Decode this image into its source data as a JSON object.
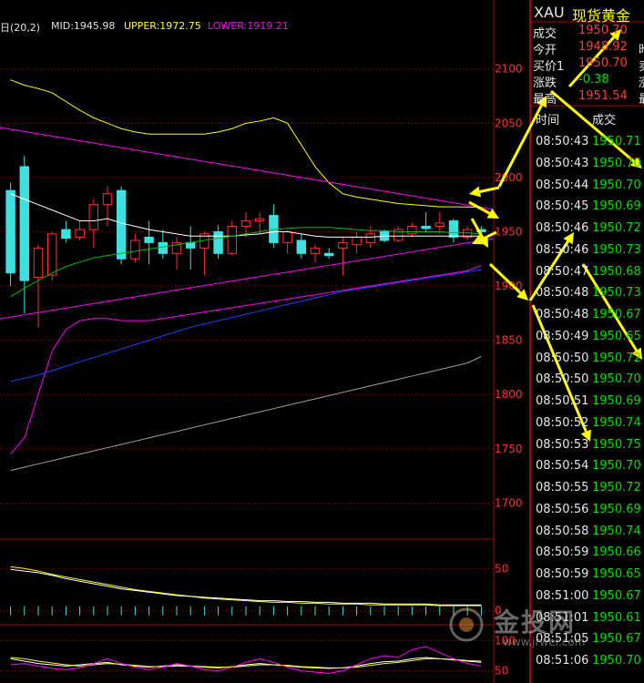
{
  "indicator": {
    "name": "日(20,2)",
    "mid": "MID:1945.98",
    "upper": "UPPER:1972.75",
    "lower": "LOWER:1919.21",
    "colors": {
      "mid": "#ffffff",
      "upper": "#ffff00",
      "lower": "#ff00ff"
    }
  },
  "quote": {
    "symbol": "XAU",
    "name": "现货黄金",
    "rows": [
      {
        "label": "成交",
        "value": "1950.70",
        "color": "red",
        "edge": ""
      },
      {
        "label": "今开",
        "value": "1948.92",
        "color": "red",
        "edge": "昨"
      },
      {
        "label": "买价1",
        "value": "1950.70",
        "color": "red",
        "edge": "卖"
      },
      {
        "label": "涨跌",
        "value": "-0.38",
        "color": "green",
        "edge": "涨"
      },
      {
        "label": "最高",
        "value": "1951.54",
        "color": "red",
        "edge": "最"
      }
    ],
    "ticks_header": {
      "time": "时间",
      "price": "成交"
    },
    "ticks": [
      {
        "time": "08:50:43",
        "price": "1950.71"
      },
      {
        "time": "08:50:43",
        "price": "1950.70"
      },
      {
        "time": "08:50:44",
        "price": "1950.70"
      },
      {
        "time": "08:50:45",
        "price": "1950.69"
      },
      {
        "time": "08:50:46",
        "price": "1950.72"
      },
      {
        "time": "08:50:46",
        "price": "1950.73"
      },
      {
        "time": "08:50:47",
        "price": "1950.68"
      },
      {
        "time": "08:50:48",
        "price": "1950.73"
      },
      {
        "time": "08:50:48",
        "price": "1950.67"
      },
      {
        "time": "08:50:49",
        "price": "1950.65"
      },
      {
        "time": "08:50:50",
        "price": "1950.72"
      },
      {
        "time": "08:50:50",
        "price": "1950.70"
      },
      {
        "time": "08:50:51",
        "price": "1950.69"
      },
      {
        "time": "08:50:52",
        "price": "1950.74"
      },
      {
        "time": "08:50:53",
        "price": "1950.75"
      },
      {
        "time": "08:50:54",
        "price": "1950.70"
      },
      {
        "time": "08:50:55",
        "price": "1950.72"
      },
      {
        "time": "08:50:56",
        "price": "1950.69"
      },
      {
        "time": "08:50:58",
        "price": "1950.74"
      },
      {
        "time": "08:50:59",
        "price": "1950.66"
      },
      {
        "time": "08:50:59",
        "price": "1950.65"
      },
      {
        "time": "08:51:00",
        "price": "1950.67"
      },
      {
        "time": "08:51:01",
        "price": "1950.61"
      },
      {
        "time": "08:51:05",
        "price": "1950.67"
      },
      {
        "time": "08:51:06",
        "price": "1950.70"
      }
    ]
  },
  "watermark": {
    "text": "金投网",
    "url": "www.jrwei.com"
  },
  "colors": {
    "up": "#ff3030",
    "down": "#40e0e0",
    "grid": "#8b1010",
    "axis_text": "#ff3030",
    "arrow": "#ffff00",
    "trend": "#ff00ff"
  },
  "chart_data": [
    {
      "type": "candlestick",
      "title": "",
      "ylim": [
        1660,
        2130
      ],
      "y_ticks": [
        1700,
        1750,
        1800,
        1850,
        1900,
        1950,
        2000,
        2050,
        2100
      ],
      "candles": [
        {
          "o": 1988,
          "h": 1995,
          "l": 1900,
          "c": 1912
        },
        {
          "o": 2010,
          "h": 2020,
          "l": 1875,
          "c": 1905
        },
        {
          "o": 1908,
          "h": 1938,
          "l": 1862,
          "c": 1935
        },
        {
          "o": 1910,
          "h": 1950,
          "l": 1905,
          "c": 1948
        },
        {
          "o": 1952,
          "h": 1960,
          "l": 1940,
          "c": 1944
        },
        {
          "o": 1945,
          "h": 1960,
          "l": 1942,
          "c": 1952
        },
        {
          "o": 1952,
          "h": 1980,
          "l": 1935,
          "c": 1975
        },
        {
          "o": 1975,
          "h": 1992,
          "l": 1955,
          "c": 1985
        },
        {
          "o": 1988,
          "h": 1992,
          "l": 1920,
          "c": 1925
        },
        {
          "o": 1925,
          "h": 1948,
          "l": 1922,
          "c": 1942
        },
        {
          "o": 1945,
          "h": 1960,
          "l": 1920,
          "c": 1940
        },
        {
          "o": 1940,
          "h": 1952,
          "l": 1925,
          "c": 1930
        },
        {
          "o": 1930,
          "h": 1945,
          "l": 1915,
          "c": 1940
        },
        {
          "o": 1940,
          "h": 1955,
          "l": 1915,
          "c": 1935
        },
        {
          "o": 1935,
          "h": 1950,
          "l": 1910,
          "c": 1948
        },
        {
          "o": 1950,
          "h": 1956,
          "l": 1925,
          "c": 1930
        },
        {
          "o": 1930,
          "h": 1960,
          "l": 1928,
          "c": 1955
        },
        {
          "o": 1955,
          "h": 1968,
          "l": 1945,
          "c": 1960
        },
        {
          "o": 1960,
          "h": 1968,
          "l": 1948,
          "c": 1962
        },
        {
          "o": 1965,
          "h": 1975,
          "l": 1935,
          "c": 1940
        },
        {
          "o": 1940,
          "h": 1952,
          "l": 1930,
          "c": 1950
        },
        {
          "o": 1942,
          "h": 1948,
          "l": 1925,
          "c": 1930
        },
        {
          "o": 1930,
          "h": 1938,
          "l": 1922,
          "c": 1935
        },
        {
          "o": 1930,
          "h": 1935,
          "l": 1925,
          "c": 1928
        },
        {
          "o": 1935,
          "h": 1945,
          "l": 1910,
          "c": 1940
        },
        {
          "o": 1938,
          "h": 1950,
          "l": 1930,
          "c": 1945
        },
        {
          "o": 1940,
          "h": 1955,
          "l": 1935,
          "c": 1948
        },
        {
          "o": 1950,
          "h": 1952,
          "l": 1940,
          "c": 1942
        },
        {
          "o": 1942,
          "h": 1955,
          "l": 1940,
          "c": 1952
        },
        {
          "o": 1948,
          "h": 1958,
          "l": 1945,
          "c": 1955
        },
        {
          "o": 1955,
          "h": 1968,
          "l": 1950,
          "c": 1953
        },
        {
          "o": 1955,
          "h": 1968,
          "l": 1948,
          "c": 1958
        },
        {
          "o": 1960,
          "h": 1962,
          "l": 1940,
          "c": 1945
        },
        {
          "o": 1945,
          "h": 1955,
          "l": 1942,
          "c": 1952
        },
        {
          "o": 1952,
          "h": 1955,
          "l": 1946,
          "c": 1950
        }
      ],
      "series": [
        {
          "color": "#ffff00",
          "values": [
            2090,
            2085,
            2082,
            2078,
            2070,
            2062,
            2055,
            2050,
            2045,
            2042,
            2040,
            2040,
            2040,
            2040,
            2040,
            2042,
            2045,
            2050,
            2052,
            2055,
            2050,
            2030,
            2010,
            1995,
            1985,
            1982,
            1980,
            1978,
            1976,
            1975,
            1974,
            1973,
            1973,
            1972.75,
            1972.75
          ]
        },
        {
          "color": "#ffffff",
          "values": [
            1985,
            1980,
            1975,
            1970,
            1965,
            1960,
            1960,
            1962,
            1958,
            1955,
            1952,
            1950,
            1948,
            1946,
            1946,
            1946,
            1946,
            1947,
            1948,
            1950,
            1950,
            1948,
            1946,
            1945,
            1945,
            1945,
            1945,
            1946,
            1946,
            1946,
            1946,
            1946,
            1946,
            1946,
            1945.98
          ]
        },
        {
          "color": "#00c000",
          "values": [
            1890,
            1898,
            1905,
            1912,
            1918,
            1922,
            1926,
            1928,
            1930,
            1932,
            1934,
            1936,
            1938,
            1940,
            1942,
            1944,
            1946,
            1948,
            1950,
            1952,
            1953,
            1954,
            1954,
            1954,
            1953,
            1952,
            1951,
            1951,
            1950,
            1950,
            1950,
            1950,
            1949,
            1949,
            1948
          ]
        },
        {
          "color": "#ff00ff",
          "values": [
            1745,
            1760,
            1800,
            1840,
            1860,
            1868,
            1870,
            1870,
            1868,
            1868,
            1868,
            1870,
            1872,
            1874,
            1876,
            1878,
            1880,
            1882,
            1884,
            1886,
            1888,
            1890,
            1892,
            1894,
            1896,
            1898,
            1900,
            1902,
            1904,
            1906,
            1908,
            1910,
            1912,
            1914,
            1919.21
          ]
        },
        {
          "color": "#2040ff",
          "values": [
            1812,
            1815,
            1818,
            1822,
            1826,
            1830,
            1834,
            1838,
            1842,
            1846,
            1850,
            1854,
            1858,
            1862,
            1865,
            1868,
            1871,
            1874,
            1877,
            1880,
            1883,
            1886,
            1889,
            1892,
            1895,
            1897,
            1899,
            1901,
            1903,
            1905,
            1907,
            1909,
            1911,
            1913,
            1915
          ]
        },
        {
          "color": "#a0a0a0",
          "values": [
            1730,
            1733,
            1736,
            1739,
            1742,
            1745,
            1748,
            1751,
            1754,
            1757,
            1760,
            1763,
            1766,
            1769,
            1772,
            1775,
            1778,
            1781,
            1784,
            1787,
            1790,
            1793,
            1796,
            1799,
            1802,
            1805,
            1808,
            1811,
            1814,
            1817,
            1820,
            1823,
            1826,
            1829,
            1835
          ]
        }
      ]
    },
    {
      "type": "line",
      "title": "",
      "ylim": [
        -10,
        60
      ],
      "y_ticks": [
        0,
        50
      ],
      "series": [
        {
          "color": "#ffff00",
          "values": [
            52,
            50,
            47,
            43,
            40,
            37,
            34,
            31,
            28,
            25,
            23,
            21,
            19,
            17,
            15,
            14,
            13,
            12,
            11,
            10,
            10,
            9,
            9,
            8,
            8,
            8,
            7,
            7,
            7,
            7,
            7,
            6,
            6,
            6,
            6
          ]
        },
        {
          "color": "#ffffff",
          "values": [
            49,
            47,
            45,
            42,
            38,
            35,
            32,
            29,
            26,
            24,
            22,
            20,
            18,
            17,
            16,
            15,
            14,
            13,
            12,
            12,
            11,
            11,
            10,
            10,
            9,
            9,
            9,
            8,
            8,
            8,
            8,
            7,
            7,
            7,
            7
          ]
        }
      ]
    },
    {
      "type": "line",
      "title": "",
      "ylim": [
        30,
        120
      ],
      "y_ticks": [
        50,
        100
      ],
      "series": [
        {
          "color": "#ffffff",
          "values": [
            70,
            66,
            62,
            60,
            58,
            60,
            62,
            64,
            60,
            58,
            56,
            58,
            60,
            58,
            56,
            55,
            57,
            60,
            62,
            60,
            58,
            56,
            55,
            54,
            55,
            58,
            62,
            65,
            66,
            70,
            72,
            70,
            68,
            66,
            64
          ]
        },
        {
          "color": "#ffff00",
          "values": [
            72,
            70,
            66,
            63,
            60,
            58,
            60,
            62,
            61,
            59,
            57,
            57,
            58,
            58,
            57,
            56,
            56,
            58,
            60,
            60,
            59,
            57,
            56,
            55,
            55,
            56,
            59,
            62,
            64,
            67,
            70,
            70,
            69,
            67,
            66
          ]
        },
        {
          "color": "#ff00ff",
          "values": [
            60,
            62,
            58,
            54,
            52,
            55,
            62,
            70,
            62,
            56,
            52,
            56,
            62,
            58,
            52,
            50,
            56,
            64,
            70,
            64,
            56,
            50,
            48,
            46,
            50,
            60,
            70,
            75,
            72,
            85,
            90,
            80,
            70,
            62,
            58
          ]
        }
      ]
    }
  ]
}
